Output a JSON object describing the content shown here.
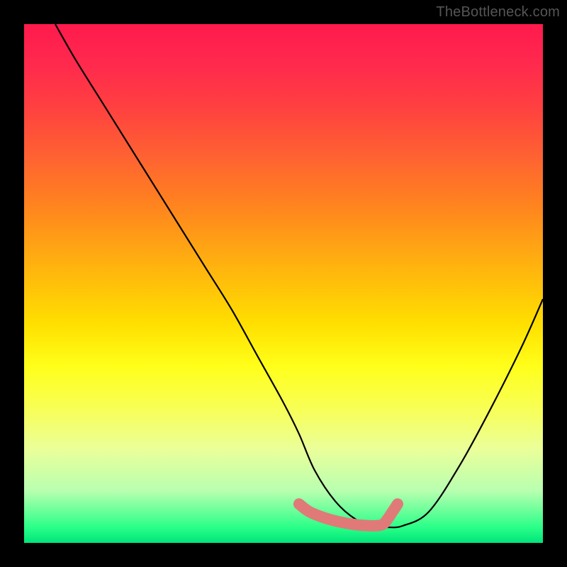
{
  "watermark": "TheBottleneck.com",
  "chart_data": {
    "type": "line",
    "title": "",
    "xlabel": "",
    "ylabel": "",
    "xlim": [
      0,
      100
    ],
    "ylim": [
      0,
      100
    ],
    "series": [
      {
        "name": "curve",
        "color": "#000000",
        "x": [
          6,
          10,
          15,
          20,
          25,
          30,
          35,
          40,
          45,
          50,
          53,
          56,
          60,
          64,
          68,
          70,
          73,
          78,
          84,
          90,
          96,
          100
        ],
        "y": [
          100,
          93,
          85,
          77,
          69,
          61,
          53,
          45,
          36,
          27,
          21,
          14,
          8,
          4.5,
          3,
          3,
          3.3,
          6,
          15,
          26,
          38,
          47
        ]
      },
      {
        "name": "highlight-band",
        "color": "#e07a78",
        "x": [
          53,
          55,
          58,
          61,
          64,
          67,
          69,
          70,
          71,
          72
        ],
        "y": [
          7.5,
          6,
          4.8,
          4,
          3.5,
          3.3,
          3.5,
          4.5,
          6,
          7.5
        ]
      }
    ]
  }
}
